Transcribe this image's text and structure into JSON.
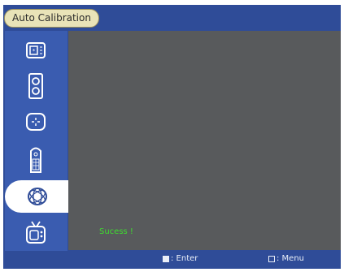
{
  "window": {
    "title": "Auto Calibration"
  },
  "sidebar": {
    "items": [
      {
        "icon": "picture-icon",
        "selected": false
      },
      {
        "icon": "speaker-icon",
        "selected": false
      },
      {
        "icon": "target-icon",
        "selected": false
      },
      {
        "icon": "remote-icon",
        "selected": false
      },
      {
        "icon": "calibration-icon",
        "selected": true
      },
      {
        "icon": "tv-icon",
        "selected": false
      }
    ]
  },
  "main": {
    "status": "Sucess !"
  },
  "footer": {
    "enter_label": ": Enter",
    "menu_label": ": Menu"
  },
  "colors": {
    "frame": "#2f4c98",
    "sidebar": "#3a5cb0",
    "content": "#585a5c",
    "status": "#3fdc2f",
    "title_pill": "#e9e3b8"
  }
}
